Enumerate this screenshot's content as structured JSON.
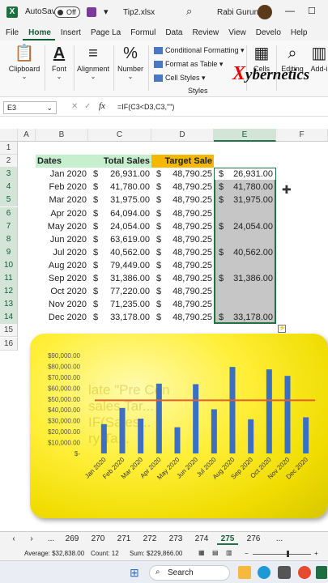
{
  "titlebar": {
    "autosave_label": "AutoSave",
    "autosave_state": "Off",
    "filename": "Tip2.xlsx",
    "user": "Rabi Gurung"
  },
  "menu_tabs": [
    "File",
    "Home",
    "Insert",
    "Page La",
    "Formul",
    "Data",
    "Review",
    "View",
    "Develo",
    "Help"
  ],
  "ribbon": {
    "clipboard": "Clipboard",
    "font": "Font",
    "alignment": "Alignment",
    "number": "Number",
    "conditional_formatting": "Conditional Formatting",
    "format_as_table": "Format as Table",
    "cell_styles": "Cell Styles",
    "styles_group": "Styles",
    "cells": "Cells",
    "editing": "Editing",
    "addins": "Add-i",
    "brand": "ybernetics",
    "brand_x": "X"
  },
  "formula_bar": {
    "name_box": "E3",
    "fx": "fx",
    "formula": "=IF(C3<D3,C3,\"\")"
  },
  "columns": [
    "A",
    "B",
    "C",
    "D",
    "E",
    "F"
  ],
  "headers": {
    "dates": "Dates",
    "total_sales": "Total Sales",
    "target_sale": "Target Sale"
  },
  "rows": [
    {
      "date": "Jan 2020",
      "sales": "26,931.00",
      "target": "48,790.25",
      "e": "26,931.00"
    },
    {
      "date": "Feb 2020",
      "sales": "41,780.00",
      "target": "48,790.25",
      "e": "41,780.00"
    },
    {
      "date": "Mar 2020",
      "sales": "31,975.00",
      "target": "48,790.25",
      "e": "31,975.00"
    },
    {
      "date": "Apr 2020",
      "sales": "64,094.00",
      "target": "48,790.25",
      "e": ""
    },
    {
      "date": "May 2020",
      "sales": "24,054.00",
      "target": "48,790.25",
      "e": "24,054.00"
    },
    {
      "date": "Jun 2020",
      "sales": "63,619.00",
      "target": "48,790.25",
      "e": ""
    },
    {
      "date": "Jul 2020",
      "sales": "40,562.00",
      "target": "48,790.25",
      "e": "40,562.00"
    },
    {
      "date": "Aug 2020",
      "sales": "79,449.00",
      "target": "48,790.25",
      "e": ""
    },
    {
      "date": "Sep 2020",
      "sales": "31,386.00",
      "target": "48,790.25",
      "e": "31,386.00"
    },
    {
      "date": "Oct 2020",
      "sales": "77,220.00",
      "target": "48,790.25",
      "e": ""
    },
    {
      "date": "Nov 2020",
      "sales": "71,235.00",
      "target": "48,790.25",
      "e": ""
    },
    {
      "date": "Dec 2020",
      "sales": "33,178.00",
      "target": "48,790.25",
      "e": "33,178.00"
    }
  ],
  "currency": "$",
  "chart_watermark": [
    "late \"Pre Con",
    "sales Tar...",
    "IF(Sales...",
    "ry Ta..."
  ],
  "chart_data": {
    "type": "bar",
    "categories": [
      "Jan 2020",
      "Feb 2020",
      "Mar 2020",
      "Apr 2020",
      "May 2020",
      "Jun 2020",
      "Jul 2020",
      "Aug 2020",
      "Sep 2020",
      "Oct 2020",
      "Nov 2020",
      "Dec 2020"
    ],
    "series": [
      {
        "type": "bar",
        "values": [
          26931,
          41780,
          31975,
          64094,
          24054,
          63619,
          40562,
          79449,
          31386,
          77220,
          71235,
          33178
        ],
        "color": "#3a6fc4"
      },
      {
        "type": "line",
        "values": [
          48790.25,
          48790.25,
          48790.25,
          48790.25,
          48790.25,
          48790.25,
          48790.25,
          48790.25,
          48790.25,
          48790.25,
          48790.25,
          48790.25
        ],
        "color": "#e0622a"
      }
    ],
    "ytick_labels": [
      "$-",
      "$10,000.00",
      "$20,000.00",
      "$30,000.00",
      "$40,000.00",
      "$50,000.00",
      "$60,000.00",
      "$70,000.00",
      "$80,000.00",
      "$90,000.00"
    ],
    "ylim": [
      0,
      90000
    ]
  },
  "sheet_tabs": [
    "...",
    "269",
    "270",
    "271",
    "272",
    "273",
    "274",
    "275",
    "276",
    "..."
  ],
  "active_sheet": "275",
  "status": {
    "average": "Average: $32,838.00",
    "count": "Count: 12",
    "sum": "Sum: $229,866.00"
  },
  "taskbar": {
    "search": "Search"
  }
}
